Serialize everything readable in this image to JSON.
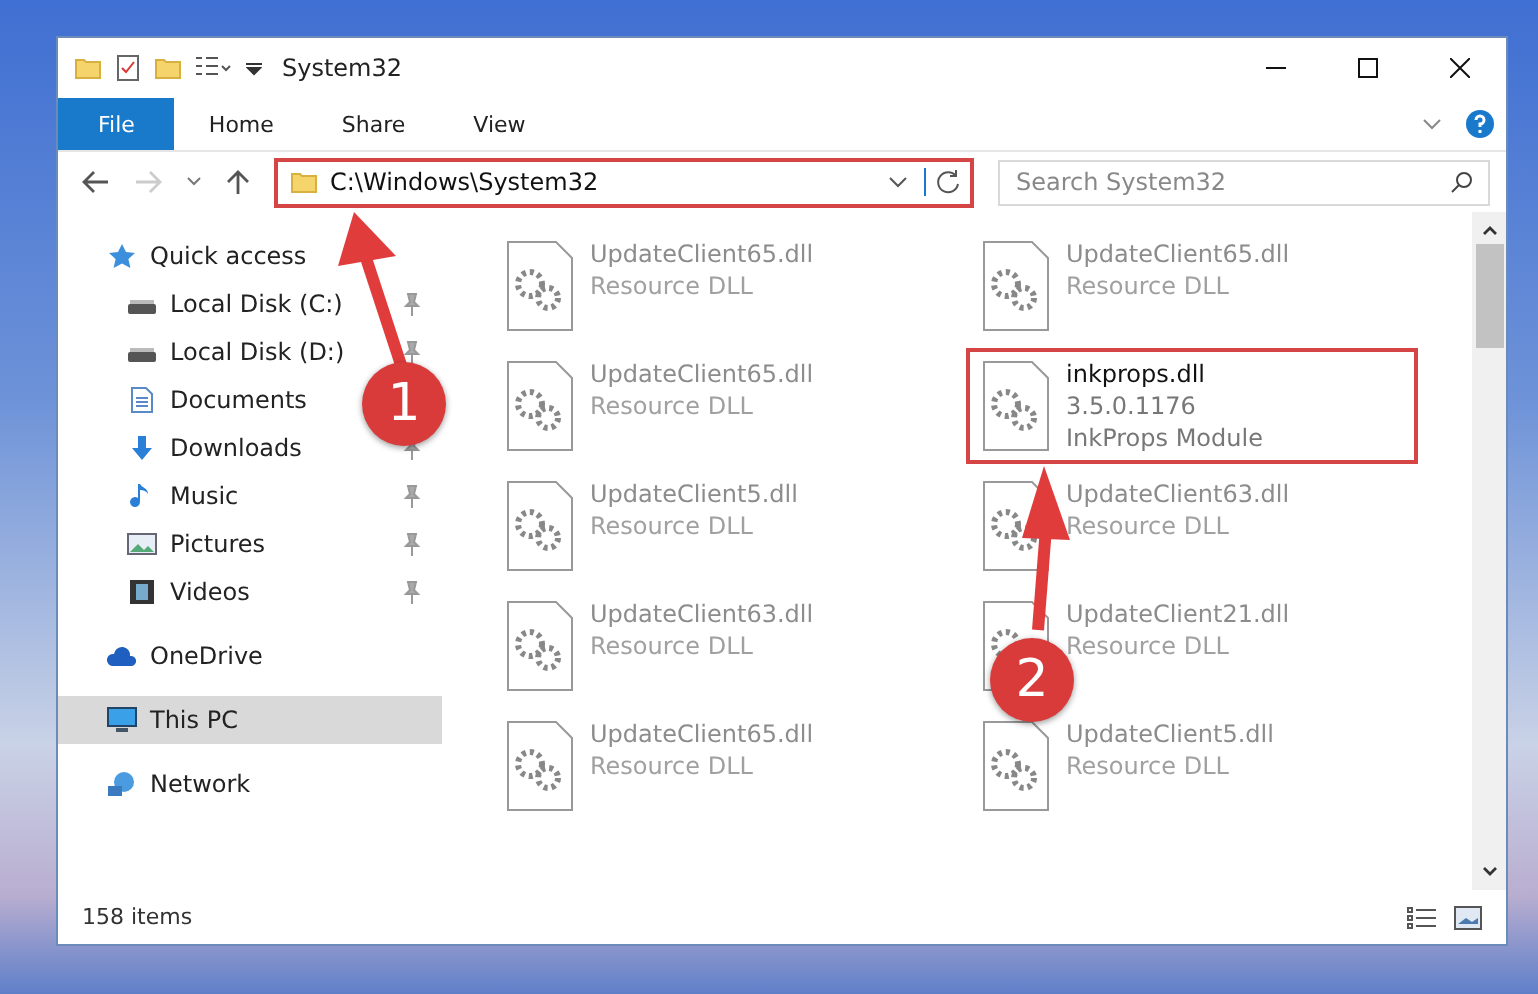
{
  "window": {
    "title": "System32"
  },
  "ribbon": {
    "tabs": [
      {
        "label": "File",
        "kind": "app"
      },
      {
        "label": "Home",
        "kind": "tab"
      },
      {
        "label": "Share",
        "kind": "tab"
      },
      {
        "label": "View",
        "kind": "tab"
      }
    ]
  },
  "address": {
    "path": "C:\\Windows\\System32",
    "highlighted": true,
    "search_placeholder": "Search System32"
  },
  "sidebar": {
    "items": [
      {
        "label": "Quick access",
        "kind": "star",
        "selected": false,
        "children": [
          {
            "label": "Local Disk (C:)",
            "kind": "drive",
            "pinned": true,
            "selected": false
          },
          {
            "label": "Local Disk (D:)",
            "kind": "drive",
            "pinned": true,
            "selected": false
          },
          {
            "label": "Documents",
            "kind": "document",
            "pinned": false,
            "selected": false
          },
          {
            "label": "Downloads",
            "kind": "download",
            "pinned": true,
            "selected": false
          },
          {
            "label": "Music",
            "kind": "music",
            "pinned": true,
            "selected": false
          },
          {
            "label": "Pictures",
            "kind": "picture",
            "pinned": true,
            "selected": false
          },
          {
            "label": "Videos",
            "kind": "video",
            "pinned": true,
            "selected": false
          }
        ]
      },
      {
        "label": "OneDrive",
        "kind": "cloud",
        "selected": false
      },
      {
        "label": "This PC",
        "kind": "computer",
        "selected": true
      },
      {
        "label": "Network",
        "kind": "network",
        "selected": false
      }
    ]
  },
  "files": [
    {
      "name": "UpdateClient65.dll",
      "lines": [
        "Resource DLL"
      ],
      "faded": true,
      "highlighted": false
    },
    {
      "name": "UpdateClient65.dll",
      "lines": [
        "Resource DLL"
      ],
      "faded": true,
      "highlighted": false
    },
    {
      "name": "UpdateClient5.dll",
      "lines": [
        "Resource DLL"
      ],
      "faded": true,
      "highlighted": false
    },
    {
      "name": "UpdateClient63.dll",
      "lines": [
        "Resource DLL"
      ],
      "faded": true,
      "highlighted": false
    },
    {
      "name": "UpdateClient65.dll",
      "lines": [
        "Resource DLL"
      ],
      "faded": true,
      "highlighted": false
    },
    {
      "name": "UpdateClient65.dll",
      "lines": [
        "Resource DLL"
      ],
      "faded": true,
      "highlighted": false
    },
    {
      "name": "inkprops.dll",
      "lines": [
        "3.5.0.1176",
        "InkProps Module"
      ],
      "faded": false,
      "highlighted": true
    },
    {
      "name": "UpdateClient63.dll",
      "lines": [
        "Resource DLL"
      ],
      "faded": true,
      "highlighted": false
    },
    {
      "name": "UpdateClient21.dll",
      "lines": [
        "Resource DLL"
      ],
      "faded": true,
      "highlighted": false
    },
    {
      "name": "UpdateClient5.dll",
      "lines": [
        "Resource DLL"
      ],
      "faded": true,
      "highlighted": false
    }
  ],
  "status_bar": {
    "count": "158 items"
  },
  "annotations": [
    {
      "label": "1"
    },
    {
      "label": "2"
    }
  ]
}
